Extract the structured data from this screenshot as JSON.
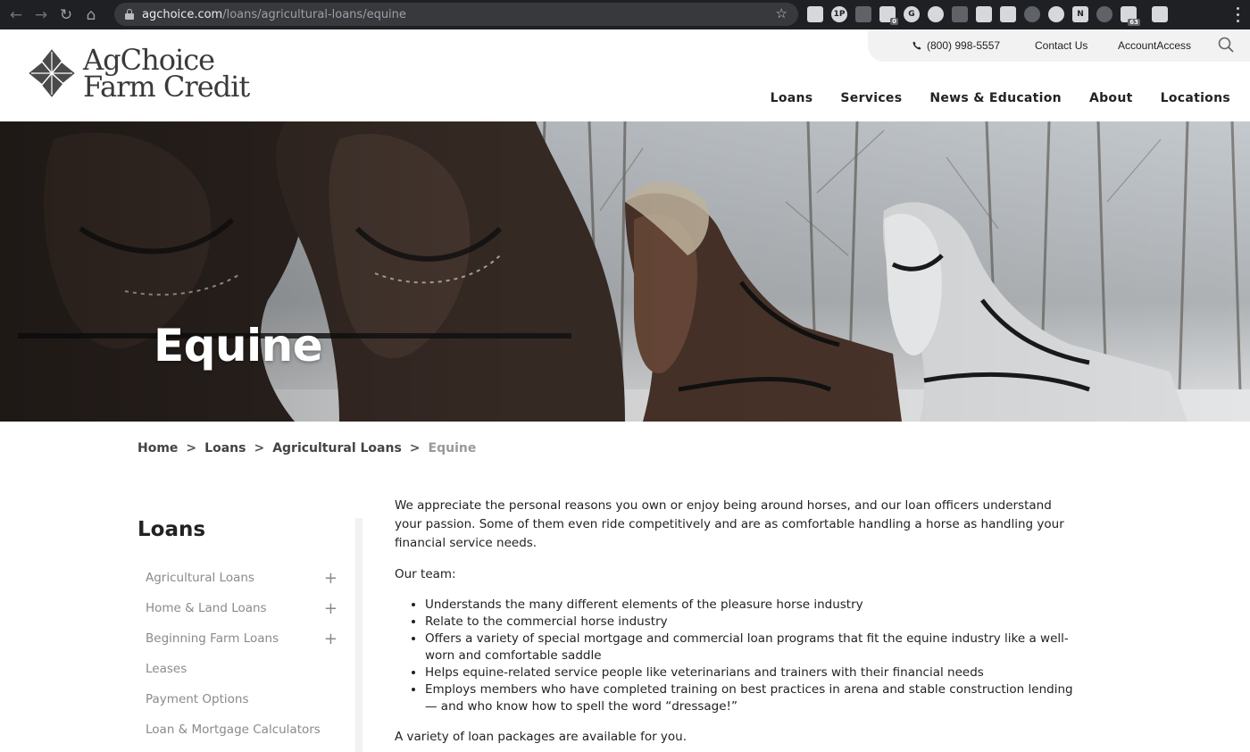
{
  "browser": {
    "url_host": "agchoice.com",
    "url_path": "/loans/agricultural-loans/equine",
    "ext_badge_1": "0",
    "ext_badge_2": "63"
  },
  "header": {
    "logo_line1": "AgChoice",
    "logo_line2": "Farm Credit",
    "phone": "(800) 998-5557",
    "contact_label": "Contact Us",
    "account_label": "AccountAccess",
    "nav": [
      "Loans",
      "Services",
      "News & Education",
      "About",
      "Locations"
    ]
  },
  "hero": {
    "title": "Equine"
  },
  "breadcrumb": {
    "items": [
      "Home",
      "Loans",
      "Agricultural Loans"
    ],
    "current": "Equine",
    "separator": ">"
  },
  "sidebar": {
    "heading": "Loans",
    "items": [
      {
        "label": "Agricultural Loans",
        "expandable": "+"
      },
      {
        "label": "Home & Land Loans",
        "expandable": "+"
      },
      {
        "label": "Beginning Farm Loans",
        "expandable": "+"
      },
      {
        "label": "Leases"
      },
      {
        "label": "Payment Options"
      },
      {
        "label": "Loan & Mortgage Calculators"
      }
    ]
  },
  "content": {
    "intro": "We appreciate the personal reasons you own or enjoy being around horses, and our loan officers understand your passion. Some of them even ride competitively and are as comfortable handling a horse as handling your financial service needs.",
    "team_label": "Our team:",
    "bullets": [
      "Understands the many different elements of the pleasure horse industry",
      "Relate to the commercial horse industry",
      "Offers a variety of special mortgage and commercial loan programs that fit the equine industry like a well-worn and comfortable saddle",
      "Helps equine-related service people like veterinarians and trainers with their financial needs",
      "Employs members who have completed training on best practices in arena and stable construction lending — and who know how to spell the word “dressage!”"
    ],
    "closing": "A variety of loan packages are available for you."
  },
  "colors": {
    "chrome_bg": "#1f2023",
    "omnibox_bg": "#38393c",
    "utility_bg": "#f2f2f2",
    "text": "#222222",
    "muted": "#8a8a8a",
    "logo": "#3a3a3a"
  }
}
